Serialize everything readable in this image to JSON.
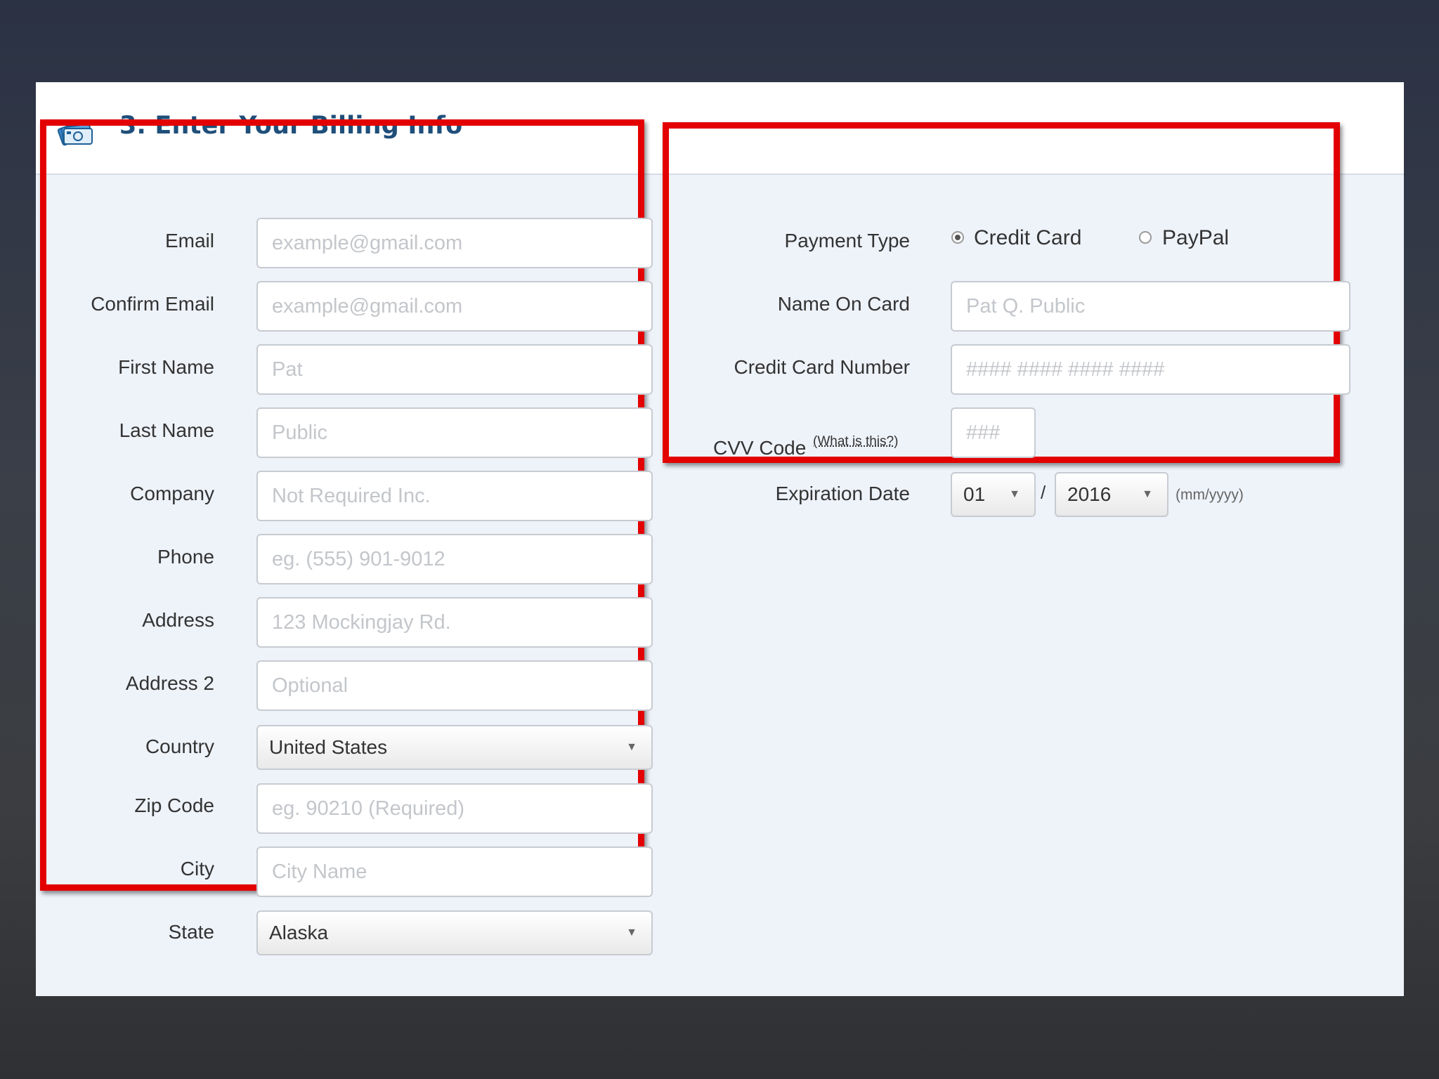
{
  "header": {
    "title": "3. Enter Your Billing Info"
  },
  "contact_form": {
    "email": {
      "label": "Email",
      "placeholder": "example@gmail.com"
    },
    "confirm_email": {
      "label": "Confirm Email",
      "placeholder": "example@gmail.com"
    },
    "first_name": {
      "label": "First Name",
      "placeholder": "Pat"
    },
    "last_name": {
      "label": "Last Name",
      "placeholder": "Public"
    },
    "company": {
      "label": "Company",
      "placeholder": "Not Required Inc."
    },
    "phone": {
      "label": "Phone",
      "placeholder": "eg. (555) 901-9012"
    },
    "address": {
      "label": "Address",
      "placeholder": "123 Mockingjay Rd."
    },
    "address2": {
      "label": "Address 2",
      "placeholder": "Optional"
    },
    "country": {
      "label": "Country",
      "value": "United States"
    },
    "zip": {
      "label": "Zip Code",
      "placeholder": "eg. 90210 (Required)"
    },
    "city": {
      "label": "City",
      "placeholder": "City Name"
    },
    "state": {
      "label": "State",
      "value": "Alaska"
    }
  },
  "payment_form": {
    "payment_type": {
      "label": "Payment Type",
      "options": [
        "Credit Card",
        "PayPal"
      ],
      "selected": "Credit Card"
    },
    "name_on_card": {
      "label": "Name On Card",
      "placeholder": "Pat Q. Public"
    },
    "card_number": {
      "label": "Credit Card Number",
      "placeholder": "#### #### #### ####"
    },
    "cvv": {
      "label": "CVV Code",
      "help_link": "(What is this?)",
      "placeholder": "###"
    },
    "expiration": {
      "label": "Expiration Date",
      "month": "01",
      "separator": "/",
      "year": "2016",
      "format_hint": "(mm/yyyy)"
    }
  },
  "icons": {
    "header": "money-cards-icon",
    "dropdown": "chevron-down-icon"
  },
  "colors": {
    "annotation": "#e30000",
    "title": "#1f4f7a"
  }
}
